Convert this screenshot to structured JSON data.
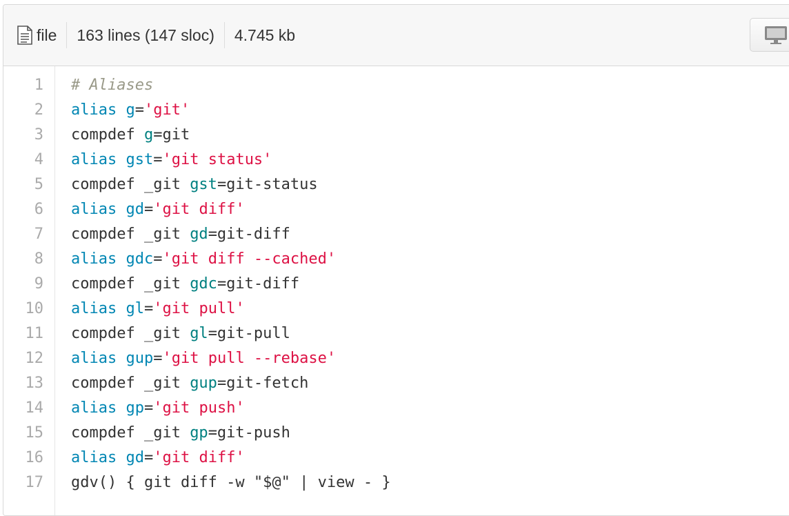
{
  "header": {
    "file_label": "file",
    "lines_info": "163 lines (147 sloc)",
    "size": "4.745 kb",
    "icons": {
      "file": "file-text-icon",
      "raw_view": "desktop-monitor-icon"
    }
  },
  "colors": {
    "comment": "#999988",
    "keyword": "#0086b3",
    "variable": "#008080",
    "string": "#dd1144",
    "text": "#333333",
    "line_number": "#aaaaaa"
  },
  "code": {
    "lines": [
      {
        "num": "1",
        "tokens": [
          {
            "t": "# Aliases",
            "k": "comment"
          }
        ]
      },
      {
        "num": "2",
        "tokens": [
          {
            "t": "alias",
            "k": "keyword"
          },
          {
            "t": " ",
            "k": "plain"
          },
          {
            "t": "g",
            "k": "keyword"
          },
          {
            "t": "=",
            "k": "plain"
          },
          {
            "t": "'git'",
            "k": "string"
          }
        ]
      },
      {
        "num": "3",
        "tokens": [
          {
            "t": "compdef ",
            "k": "plain"
          },
          {
            "t": "g",
            "k": "var"
          },
          {
            "t": "=git",
            "k": "plain"
          }
        ]
      },
      {
        "num": "4",
        "tokens": [
          {
            "t": "alias",
            "k": "keyword"
          },
          {
            "t": " ",
            "k": "plain"
          },
          {
            "t": "gst",
            "k": "keyword"
          },
          {
            "t": "=",
            "k": "plain"
          },
          {
            "t": "'git status'",
            "k": "string"
          }
        ]
      },
      {
        "num": "5",
        "tokens": [
          {
            "t": "compdef _git ",
            "k": "plain"
          },
          {
            "t": "gst",
            "k": "var"
          },
          {
            "t": "=git-status",
            "k": "plain"
          }
        ]
      },
      {
        "num": "6",
        "tokens": [
          {
            "t": "alias",
            "k": "keyword"
          },
          {
            "t": " ",
            "k": "plain"
          },
          {
            "t": "gd",
            "k": "keyword"
          },
          {
            "t": "=",
            "k": "plain"
          },
          {
            "t": "'git diff'",
            "k": "string"
          }
        ]
      },
      {
        "num": "7",
        "tokens": [
          {
            "t": "compdef _git ",
            "k": "plain"
          },
          {
            "t": "gd",
            "k": "var"
          },
          {
            "t": "=git-diff",
            "k": "plain"
          }
        ]
      },
      {
        "num": "8",
        "tokens": [
          {
            "t": "alias",
            "k": "keyword"
          },
          {
            "t": " ",
            "k": "plain"
          },
          {
            "t": "gdc",
            "k": "keyword"
          },
          {
            "t": "=",
            "k": "plain"
          },
          {
            "t": "'git diff --cached'",
            "k": "string"
          }
        ]
      },
      {
        "num": "9",
        "tokens": [
          {
            "t": "compdef _git ",
            "k": "plain"
          },
          {
            "t": "gdc",
            "k": "var"
          },
          {
            "t": "=git-diff",
            "k": "plain"
          }
        ]
      },
      {
        "num": "10",
        "tokens": [
          {
            "t": "alias",
            "k": "keyword"
          },
          {
            "t": " ",
            "k": "plain"
          },
          {
            "t": "gl",
            "k": "keyword"
          },
          {
            "t": "=",
            "k": "plain"
          },
          {
            "t": "'git pull'",
            "k": "string"
          }
        ]
      },
      {
        "num": "11",
        "tokens": [
          {
            "t": "compdef _git ",
            "k": "plain"
          },
          {
            "t": "gl",
            "k": "var"
          },
          {
            "t": "=git-pull",
            "k": "plain"
          }
        ]
      },
      {
        "num": "12",
        "tokens": [
          {
            "t": "alias",
            "k": "keyword"
          },
          {
            "t": " ",
            "k": "plain"
          },
          {
            "t": "gup",
            "k": "keyword"
          },
          {
            "t": "=",
            "k": "plain"
          },
          {
            "t": "'git pull --rebase'",
            "k": "string"
          }
        ]
      },
      {
        "num": "13",
        "tokens": [
          {
            "t": "compdef _git ",
            "k": "plain"
          },
          {
            "t": "gup",
            "k": "var"
          },
          {
            "t": "=git-fetch",
            "k": "plain"
          }
        ]
      },
      {
        "num": "14",
        "tokens": [
          {
            "t": "alias",
            "k": "keyword"
          },
          {
            "t": " ",
            "k": "plain"
          },
          {
            "t": "gp",
            "k": "keyword"
          },
          {
            "t": "=",
            "k": "plain"
          },
          {
            "t": "'git push'",
            "k": "string"
          }
        ]
      },
      {
        "num": "15",
        "tokens": [
          {
            "t": "compdef _git ",
            "k": "plain"
          },
          {
            "t": "gp",
            "k": "var"
          },
          {
            "t": "=git-push",
            "k": "plain"
          }
        ]
      },
      {
        "num": "16",
        "tokens": [
          {
            "t": "alias",
            "k": "keyword"
          },
          {
            "t": " ",
            "k": "plain"
          },
          {
            "t": "gd",
            "k": "keyword"
          },
          {
            "t": "=",
            "k": "plain"
          },
          {
            "t": "'git diff'",
            "k": "string"
          }
        ]
      },
      {
        "num": "17",
        "tokens": [
          {
            "t": "gdv() { git diff -w \"$@\" | view - }",
            "k": "plain"
          }
        ]
      }
    ]
  }
}
